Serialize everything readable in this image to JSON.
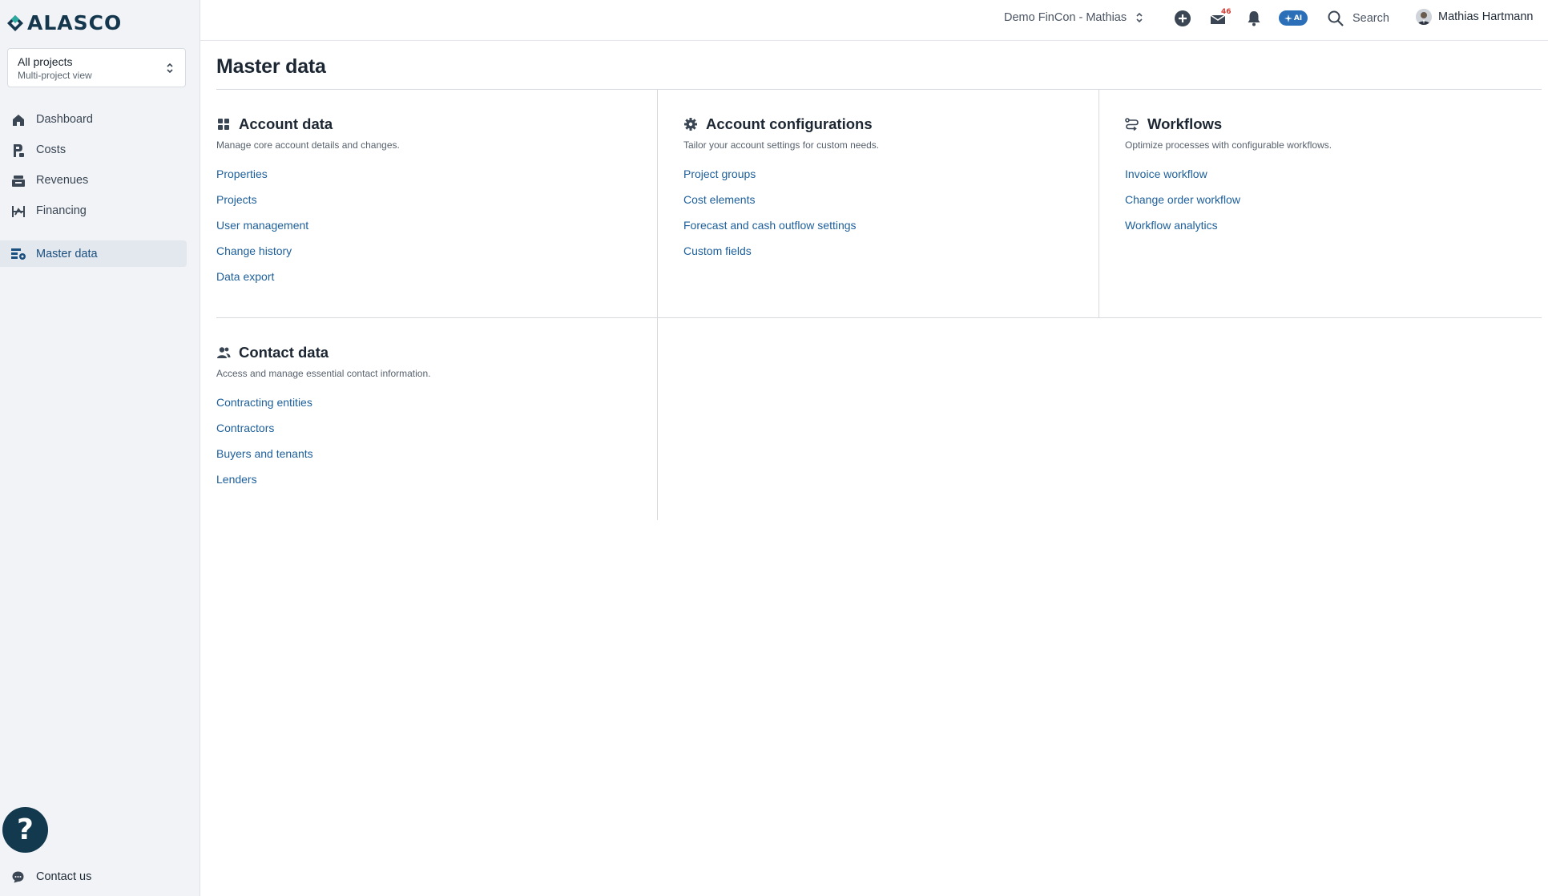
{
  "brand": {
    "name": "ALASCO"
  },
  "project_selector": {
    "title": "All projects",
    "subtitle": "Multi-project view"
  },
  "sidebar": {
    "items": [
      {
        "label": "Dashboard",
        "icon": "home-icon"
      },
      {
        "label": "Costs",
        "icon": "costs-icon"
      },
      {
        "label": "Revenues",
        "icon": "revenues-icon"
      },
      {
        "label": "Financing",
        "icon": "financing-icon"
      },
      {
        "label": "Master data",
        "icon": "master-data-icon",
        "active": true
      }
    ],
    "help_glyph": "?",
    "contact_label": "Contact us"
  },
  "topbar": {
    "account": "Demo FinCon - Mathias",
    "inbox_badge": "46",
    "ai_label": "AI",
    "search_label": "Search",
    "user_name": "Mathias Hartmann"
  },
  "page": {
    "title": "Master data"
  },
  "sections": {
    "account_data": {
      "title": "Account data",
      "description": "Manage core account details and changes.",
      "links": [
        "Properties",
        "Projects",
        "User management",
        "Change history",
        "Data export"
      ]
    },
    "account_configurations": {
      "title": "Account configurations",
      "description": "Tailor your account settings for custom needs.",
      "links": [
        "Project groups",
        "Cost elements",
        "Forecast and cash outflow settings",
        "Custom fields"
      ]
    },
    "workflows": {
      "title": "Workflows",
      "description": "Optimize processes with configurable workflows.",
      "links": [
        "Invoice workflow",
        "Change order workflow",
        "Workflow analytics"
      ]
    },
    "contact_data": {
      "title": "Contact data",
      "description": "Access and manage essential contact information.",
      "links": [
        "Contracting entities",
        "Contractors",
        "Buyers and tenants",
        "Lenders"
      ]
    }
  },
  "colors": {
    "sidebar_bg": "#f1f3f6",
    "brand_dark": "#14374e",
    "link": "#1d5f9a",
    "ai_accent": "#2a6fb8",
    "badge_red": "#d63a32"
  }
}
